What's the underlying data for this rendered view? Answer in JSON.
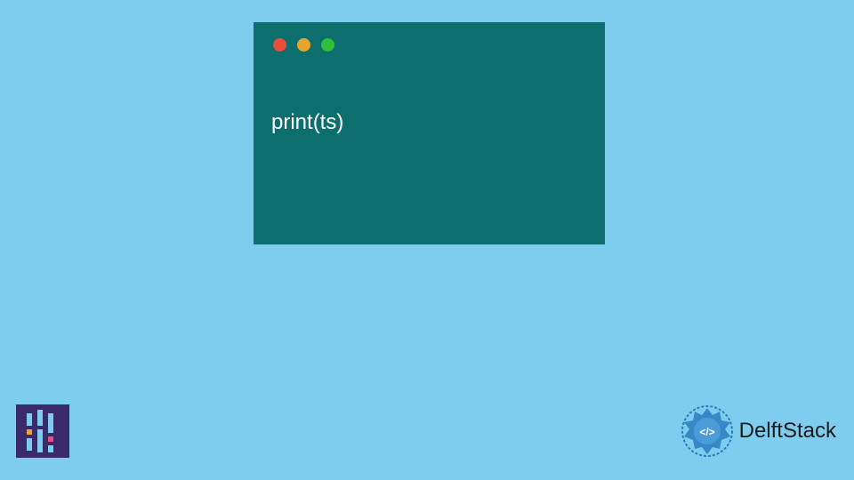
{
  "code_window": {
    "code": "print(ts)",
    "controls": {
      "red": "close-icon",
      "yellow": "minimize-icon",
      "green": "maximize-icon"
    }
  },
  "brand": {
    "name": "DelftStack",
    "emblem_color": "#2a7bbf",
    "left_logo_bg": "#3a2a6b"
  },
  "colors": {
    "background": "#7ecdee",
    "window_bg": "#0d6e6e",
    "code_text": "#ffffff"
  }
}
